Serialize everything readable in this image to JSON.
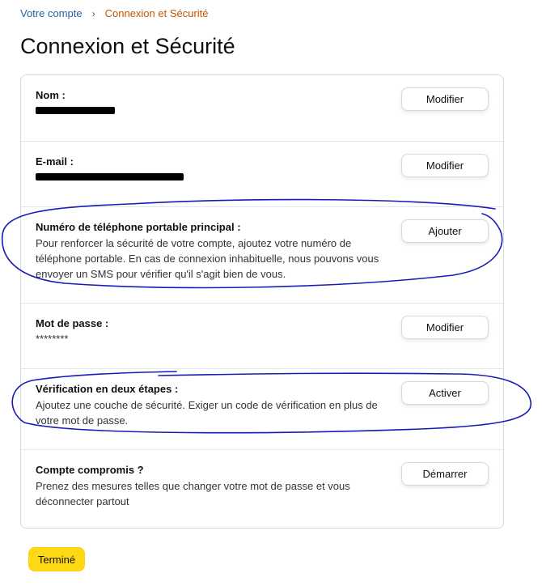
{
  "breadcrumb": {
    "parent": "Votre compte",
    "separator": "›",
    "current": "Connexion et Sécurité"
  },
  "page_title": "Connexion et Sécurité",
  "rows": {
    "name": {
      "label": "Nom :",
      "button": "Modifier"
    },
    "email": {
      "label": "E-mail :",
      "button": "Modifier"
    },
    "phone": {
      "label": "Numéro de téléphone portable principal :",
      "description": "Pour renforcer la sécurité de votre compte, ajoutez votre numéro de téléphone portable. En cas de connexion inhabituelle, nous pouvons vous envoyer un SMS pour vérifier qu'il s'agit bien de vous.",
      "button": "Ajouter"
    },
    "password": {
      "label": "Mot de passe :",
      "value": "********",
      "button": "Modifier"
    },
    "two_step": {
      "label": "Vérification en deux étapes :",
      "description": "Ajoutez une couche de sécurité. Exiger un code de vérification en plus de votre mot de passe.",
      "button": "Activer"
    },
    "compromised": {
      "label": "Compte compromis ?",
      "description": "Prenez des mesures telles que changer votre mot de passe et vous déconnecter partout",
      "button": "Démarrer"
    }
  },
  "done_button": "Terminé",
  "colors": {
    "link": "#2162a1",
    "breadcrumb_current": "#c45500",
    "primary_button": "#ffd814",
    "annotation_ink": "#1a1ab4"
  }
}
